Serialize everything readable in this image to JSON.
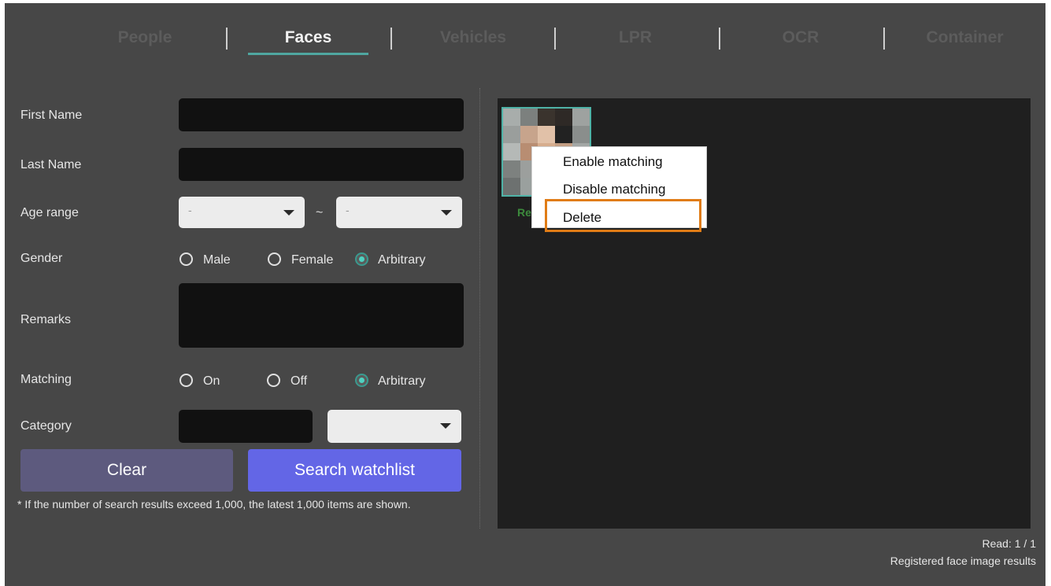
{
  "tabs": [
    "People",
    "Faces",
    "Vehicles",
    "LPR",
    "OCR",
    "Container"
  ],
  "active_tab": "Faces",
  "form": {
    "first_name_label": "First Name",
    "last_name_label": "Last Name",
    "age_range_label": "Age range",
    "age_from_value": "-",
    "age_tilde": "~",
    "age_to_value": "-",
    "gender_label": "Gender",
    "gender_options": [
      "Male",
      "Female",
      "Arbitrary"
    ],
    "gender_selected": "Arbitrary",
    "remarks_label": "Remarks",
    "matching_label": "Matching",
    "matching_options": [
      "On",
      "Off",
      "Arbitrary"
    ],
    "matching_selected": "Arbitrary",
    "category_label": "Category",
    "clear_label": "Clear",
    "search_label": "Search watchlist",
    "note": "* If the number of search results exceed 1,000, the latest 1,000 items are shown."
  },
  "results": {
    "thumb_name": "Re",
    "context_menu": [
      "Enable matching",
      "Disable matching",
      "Delete"
    ],
    "highlighted_item": "Delete",
    "read_status": "Read: 1 / 1",
    "caption": "Registered face image results"
  },
  "colors": {
    "active_tab_underline": "#4fa6a0",
    "clear_button": "#5d5a7e",
    "search_button": "#6366e6",
    "highlight": "#e07c16",
    "radio_selected": "#4fd1c0"
  }
}
